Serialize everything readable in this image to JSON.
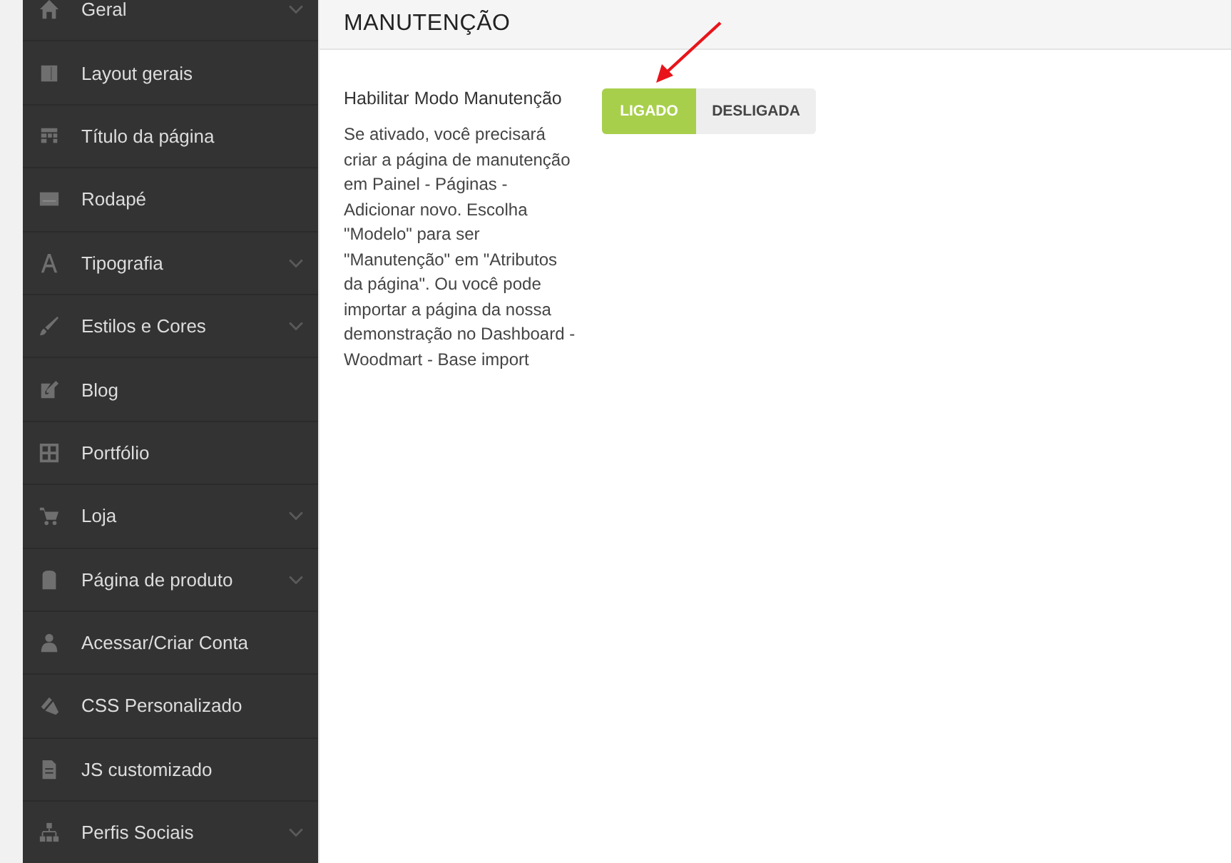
{
  "sidebar": {
    "items": [
      {
        "label": "Geral",
        "expandable": true
      },
      {
        "label": "Layout gerais",
        "expandable": false
      },
      {
        "label": "Título da página",
        "expandable": false
      },
      {
        "label": "Rodapé",
        "expandable": false
      },
      {
        "label": "Tipografia",
        "expandable": true
      },
      {
        "label": "Estilos e Cores",
        "expandable": true
      },
      {
        "label": "Blog",
        "expandable": false
      },
      {
        "label": "Portfólio",
        "expandable": false
      },
      {
        "label": "Loja",
        "expandable": true
      },
      {
        "label": "Página de produto",
        "expandable": true
      },
      {
        "label": "Acessar/Criar Conta",
        "expandable": false
      },
      {
        "label": "CSS Personalizado",
        "expandable": false
      },
      {
        "label": "JS customizado",
        "expandable": false
      },
      {
        "label": "Perfis Sociais",
        "expandable": true
      }
    ]
  },
  "section": {
    "title": "MANUTENÇÃO",
    "setting": {
      "label": "Habilitar Modo Manutenção",
      "description": "Se ativado, você precisará criar a página de manutenção em Painel - Páginas - Adicionar novo. Escolha \"Modelo\" para ser \"Manutenção\" em \"Atributos da página\". Ou você pode importar a página da nossa demonstração no Dashboard - Woodmart - Base import",
      "options": [
        {
          "label": "LIGADO",
          "selected": true
        },
        {
          "label": "DESLIGADA",
          "selected": false
        }
      ]
    }
  }
}
